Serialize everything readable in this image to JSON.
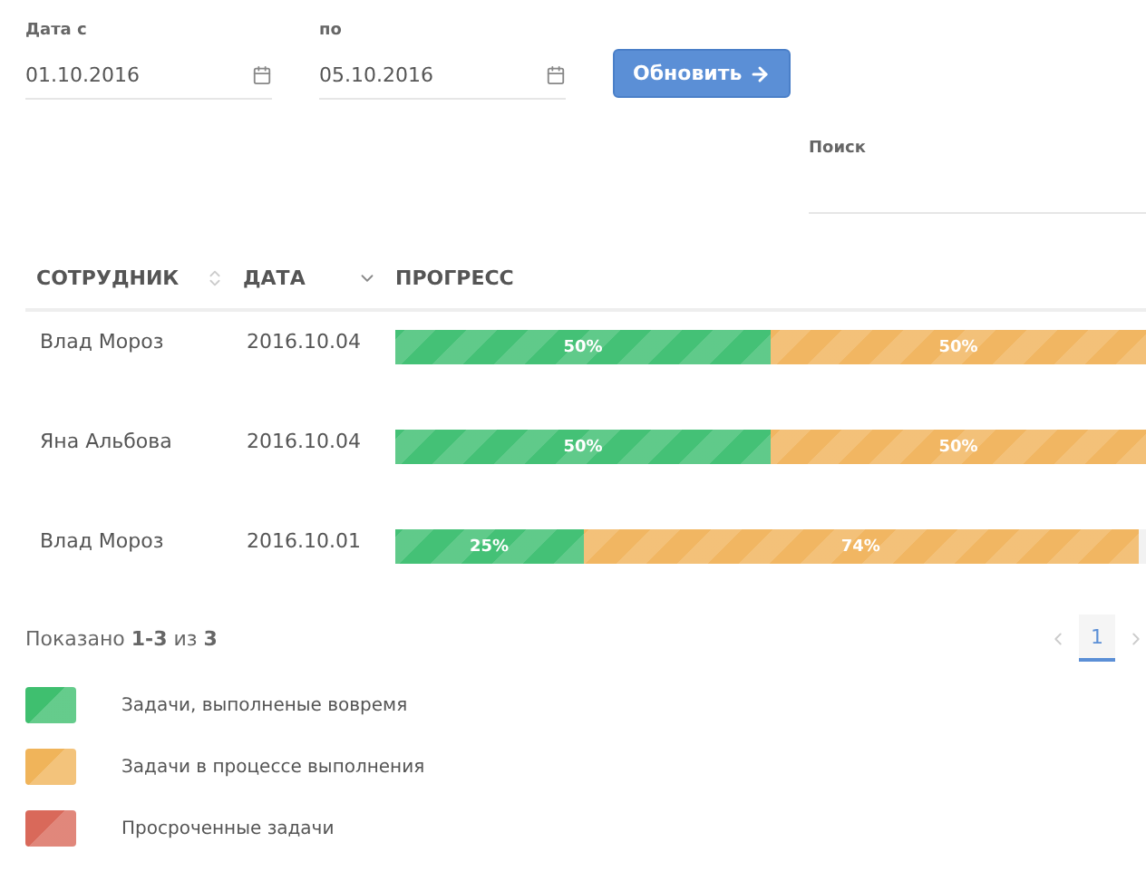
{
  "filters": {
    "from": {
      "label": "Дата с",
      "value": "01.10.2016"
    },
    "to": {
      "label": "по",
      "value": "05.10.2016"
    },
    "refresh_button": "Обновить"
  },
  "search": {
    "label": "Поиск"
  },
  "table": {
    "columns": [
      {
        "label": "СОТРУДНИК",
        "kind": "sortable"
      },
      {
        "label": "ДАТА",
        "kind": "sorted"
      },
      {
        "label": "ПРОГРЕСС",
        "kind": "plain"
      }
    ],
    "rows": [
      {
        "employee": "Влад Мороз",
        "date": "2016.10.04",
        "segments": [
          {
            "kind": "done",
            "level": 0.5,
            "label": "50%"
          },
          {
            "kind": "progress",
            "level": 0.5,
            "label": "50%"
          }
        ]
      },
      {
        "employee": "Яна Альбова",
        "date": "2016.10.04",
        "segments": [
          {
            "kind": "done",
            "level": 0.5,
            "label": "50%"
          },
          {
            "kind": "progress",
            "level": 0.5,
            "label": "50%"
          }
        ]
      },
      {
        "employee": "Влад Мороз",
        "date": "2016.10.01",
        "segments": [
          {
            "kind": "done",
            "level": 0.25,
            "label": "25%"
          },
          {
            "kind": "progress",
            "level": 0.74,
            "label": "74%"
          }
        ]
      }
    ]
  },
  "summary": "Показано **1-3** из **3**",
  "pagination": {
    "pages": [
      {
        "label": "1",
        "selected": true
      }
    ]
  },
  "legend": [
    {
      "label": "Задачи, выполненые вовремя",
      "color": "#3fbf6f"
    },
    {
      "label": "Задачи в процессе выполнения",
      "color": "#f0b45a"
    },
    {
      "label": "Просроченные задачи",
      "color": "#d9695a"
    }
  ]
}
